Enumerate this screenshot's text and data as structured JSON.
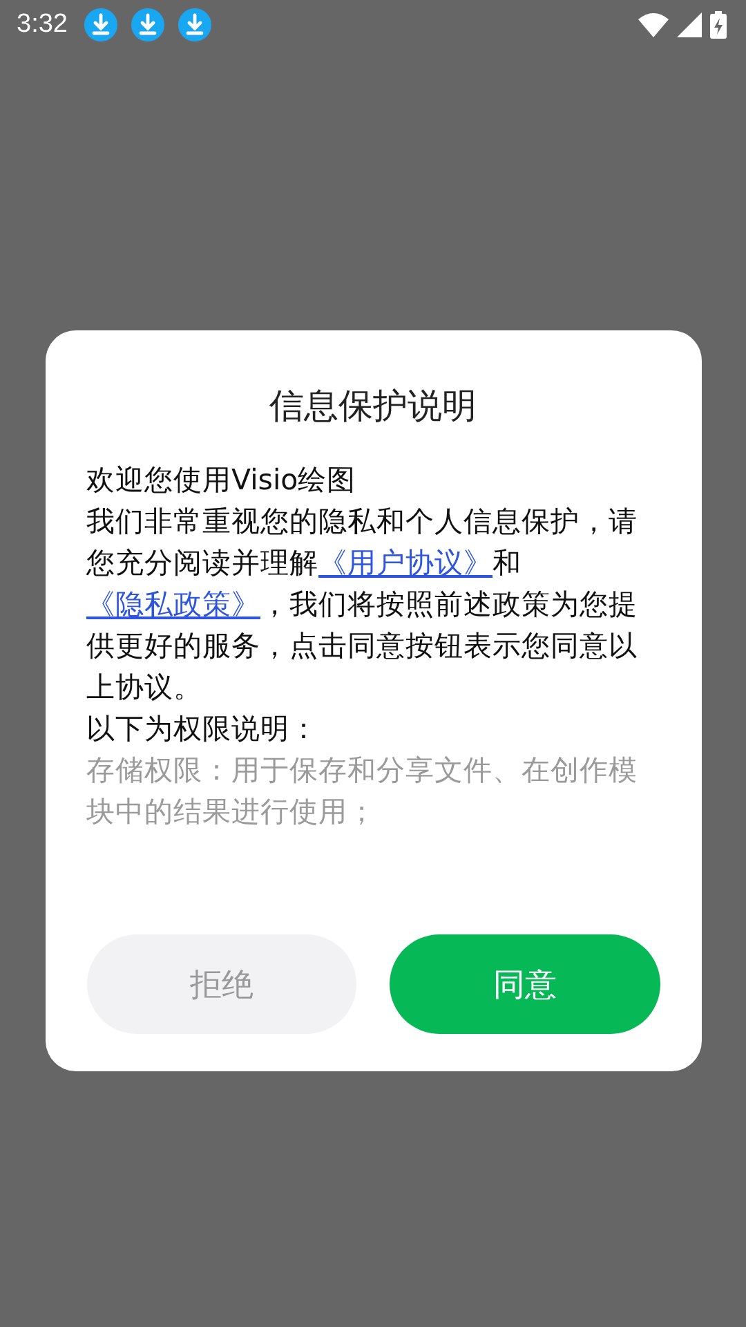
{
  "status_bar": {
    "time": "3:32",
    "downloads": [
      {
        "kind": "download"
      },
      {
        "kind": "download"
      },
      {
        "kind": "download"
      }
    ]
  },
  "dialog": {
    "title": "信息保护说明",
    "greeting": "欢迎您使用Visio绘图",
    "body": [
      {
        "kind": "text",
        "text": "我们非常重视您的隐私和个人信息保护，请您充分阅读并理解"
      },
      {
        "kind": "link",
        "text": "《用户协议》"
      },
      {
        "kind": "text",
        "text": "和"
      },
      {
        "kind": "link",
        "text": "《隐私政策》"
      },
      {
        "kind": "text",
        "text": "，我们将按照前述政策为您提供更好的服务，点击同意按钮表示您同意以上协议。"
      }
    ],
    "permissions_heading": "以下为权限说明：",
    "permissions": [
      "存储权限：用于保存和分享文件、在创作模块中的结果进行使用；"
    ],
    "buttons": [
      {
        "label": "拒绝",
        "kind": "secondary"
      },
      {
        "label": "同意",
        "kind": "primary"
      }
    ]
  }
}
